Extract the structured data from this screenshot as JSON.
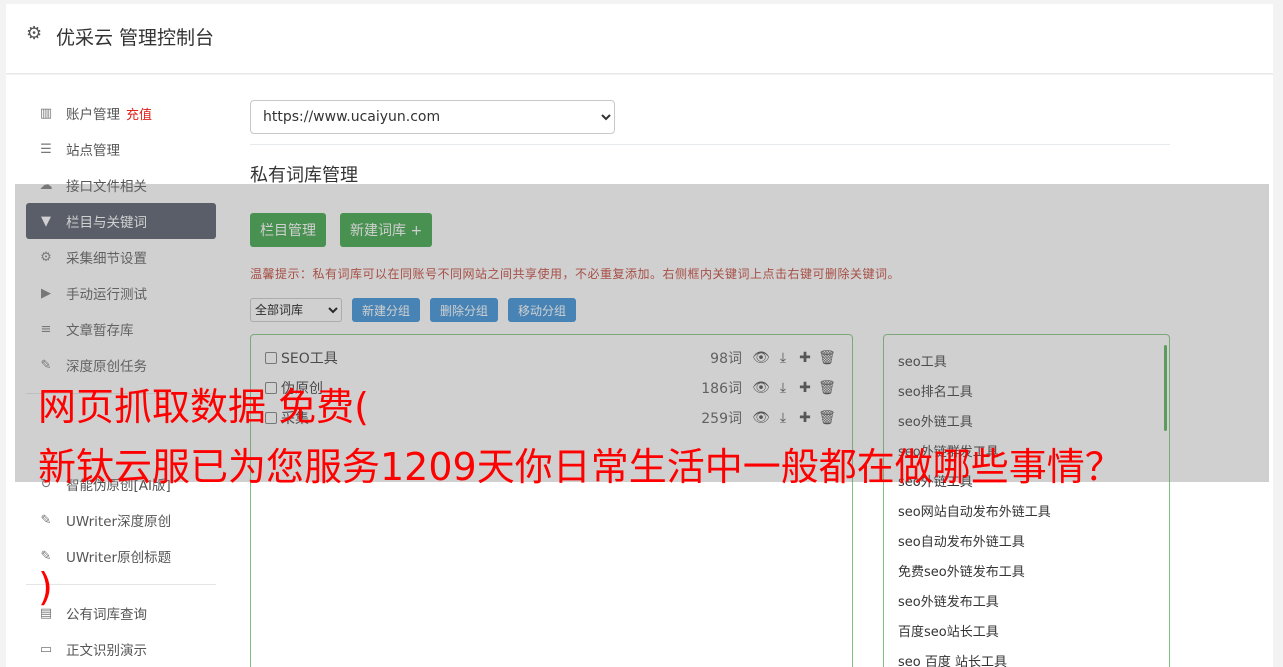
{
  "header": {
    "title": "优采云 管理控制台",
    "icon": "gear-icon"
  },
  "sidebar": {
    "items": [
      {
        "label": "账户管理",
        "badge": "充值",
        "icon": "bar-chart-icon"
      },
      {
        "label": "站点管理",
        "icon": "server-icon"
      },
      {
        "label": "接口文件相关",
        "icon": "cloud-icon"
      },
      {
        "label": "栏目与关键词",
        "icon": "filter-icon",
        "active": true
      },
      {
        "label": "采集细节设置",
        "icon": "cogs-icon"
      },
      {
        "label": "手动运行测试",
        "icon": "play-icon"
      },
      {
        "label": "文章暂存库",
        "icon": "database-icon"
      },
      {
        "label": "深度原创任务",
        "icon": "edit-icon"
      }
    ],
    "items2": [
      {
        "label": "智能伪原创[AI版]",
        "icon": "refresh-icon"
      },
      {
        "label": "UWriter深度原创",
        "icon": "edit-icon"
      },
      {
        "label": "UWriter原创标题",
        "icon": "edit-icon"
      }
    ],
    "items3": [
      {
        "label": "公有词库查询",
        "icon": "book-icon"
      },
      {
        "label": "正文识别演示",
        "icon": "monitor-icon"
      }
    ]
  },
  "main": {
    "site_value": "https://www.ucaiyun.com",
    "section_title": "私有词库管理",
    "buttons": {
      "columns": "栏目管理",
      "new_lib": "新建词库 +"
    },
    "tip": "温馨提示：私有词库可以在同账号不同网站之间共享使用，不必重复添加。右侧框内关键词上点击右键可删除关键词。",
    "group_filter": "全部词库",
    "group_buttons": {
      "new": "新建分组",
      "delete": "删除分组",
      "move": "移动分组"
    },
    "libraries": [
      {
        "name": "SEO工具",
        "count": "98词"
      },
      {
        "name": "伪原创",
        "count": "186词"
      },
      {
        "name": "采集",
        "count": "259词"
      }
    ],
    "keywords": [
      "seo工具",
      "seo排名工具",
      "seo外链工具",
      "seo外链群发工具",
      "seo外链工具",
      "seo网站自动发布外链工具",
      "seo自动发布外链工具",
      "免费seo外链发布工具",
      "seo外链发布工具",
      "百度seo站长工具",
      "seo 百度 站长工具"
    ]
  },
  "overlay": {
    "line1": "网页抓取数据 免费(",
    "line2": "新钛云服已为您服务1209天你日常生活中一般都在做哪些事情？",
    "line3": ")"
  }
}
